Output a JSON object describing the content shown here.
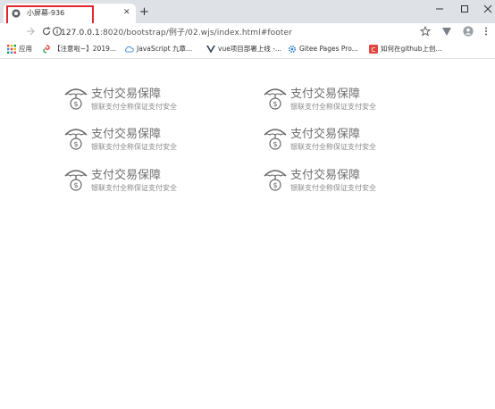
{
  "browser": {
    "tab_title": "小屏幕-936",
    "close_glyph": "✕",
    "new_tab_glyph": "+",
    "url": {
      "host": "127.0.0.1",
      "rest": ":8020/bootstrap/例子/02.wjs/index.html#footer"
    }
  },
  "bookmarks": [
    {
      "label": "应用",
      "icon": "apps-icon",
      "color": "#1a73e8"
    },
    {
      "label": "【注意啦~】2019...",
      "icon": "swirl-icon",
      "color": "#e8453c"
    },
    {
      "label": "JavaScript 九章...",
      "icon": "cloud-icon",
      "color": "#4a90d9"
    },
    {
      "label": "vue项目部署上线 -...",
      "icon": "vue-icon",
      "color": "#35495e"
    },
    {
      "label": "Gitee Pages Pro...",
      "icon": "gear-icon",
      "color": "#2a7fd0"
    },
    {
      "label": "如何在github上创...",
      "icon": "csdn-icon",
      "color": "#e0473e"
    }
  ],
  "features": [
    {
      "title": "支付交易保障",
      "subtitle": "银联支付全称保证支付安全"
    },
    {
      "title": "支付交易保障",
      "subtitle": "银联支付全称保证支付安全"
    },
    {
      "title": "支付交易保障",
      "subtitle": "银联支付全称保证支付安全"
    },
    {
      "title": "支付交易保障",
      "subtitle": "银联支付全称保证支付安全"
    },
    {
      "title": "支付交易保障",
      "subtitle": "银联支付全称保证支付安全"
    },
    {
      "title": "支付交易保障",
      "subtitle": "银联支付全称保证支付安全"
    }
  ]
}
